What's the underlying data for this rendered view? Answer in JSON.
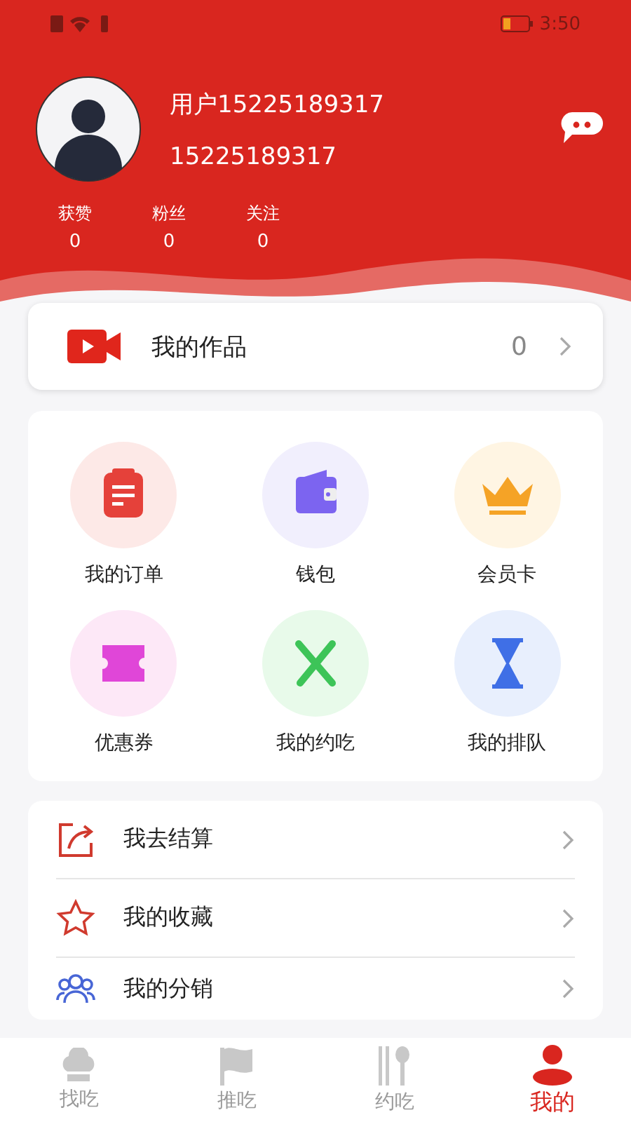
{
  "status_bar": {
    "time": "3:50"
  },
  "profile": {
    "name": "用户15225189317",
    "phone": "15225189317"
  },
  "stats": [
    {
      "label": "获赞",
      "value": "0"
    },
    {
      "label": "粉丝",
      "value": "0"
    },
    {
      "label": "关注",
      "value": "0"
    }
  ],
  "works": {
    "label": "我的作品",
    "count": "0"
  },
  "grid": [
    {
      "label": "我的订单",
      "kind": "order"
    },
    {
      "label": "钱包",
      "kind": "wallet"
    },
    {
      "label": "会员卡",
      "kind": "crown"
    },
    {
      "label": "优惠券",
      "kind": "coupon"
    },
    {
      "label": "我的约吃",
      "kind": "dining"
    },
    {
      "label": "我的排队",
      "kind": "hourglass"
    }
  ],
  "menu": [
    {
      "label": "我去结算",
      "kind": "checkout"
    },
    {
      "label": "我的收藏",
      "kind": "favorite"
    },
    {
      "label": "我的分销",
      "kind": "distribution"
    }
  ],
  "tabs": [
    {
      "label": "找吃",
      "kind": "chef",
      "selected": false
    },
    {
      "label": "推吃",
      "kind": "flag",
      "selected": false
    },
    {
      "label": "约吃",
      "kind": "utensils",
      "selected": false
    },
    {
      "label": "我的",
      "kind": "person",
      "selected": true
    }
  ]
}
